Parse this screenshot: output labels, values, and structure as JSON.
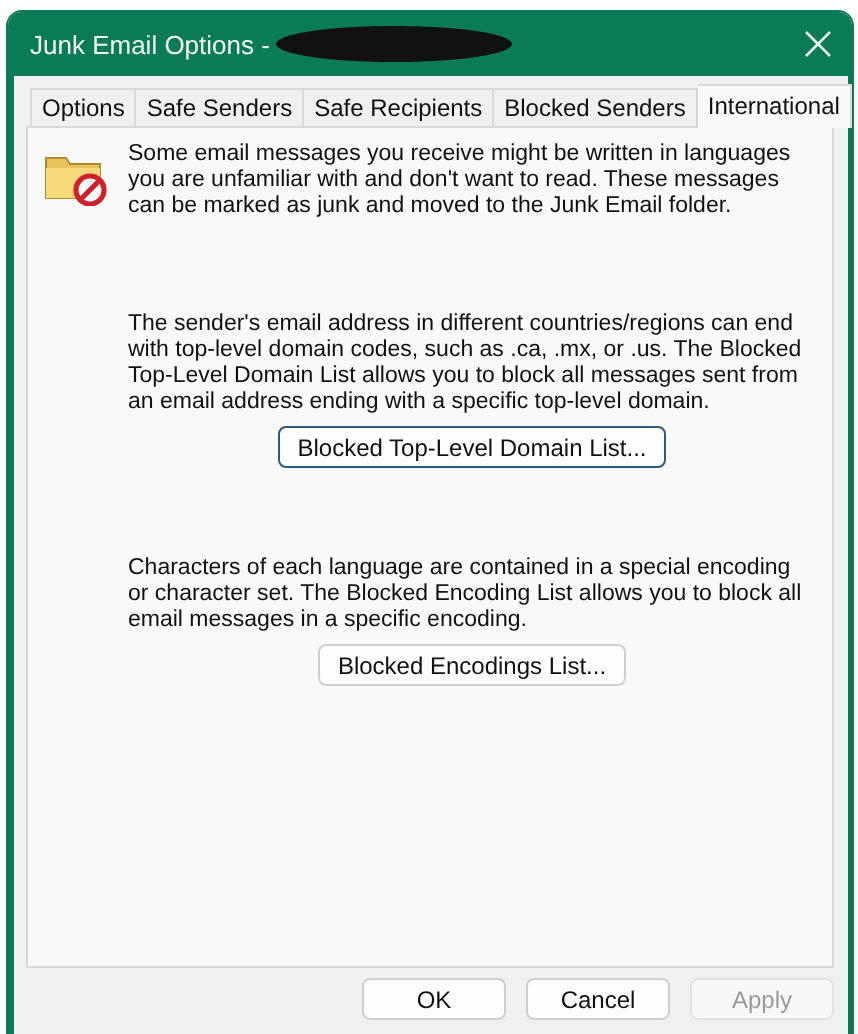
{
  "window": {
    "title": "Junk Email Options -"
  },
  "tabs": [
    {
      "label": "Options",
      "selected": false
    },
    {
      "label": "Safe Senders",
      "selected": false
    },
    {
      "label": "Safe Recipients",
      "selected": false
    },
    {
      "label": "Blocked Senders",
      "selected": false
    },
    {
      "label": "International",
      "selected": true
    }
  ],
  "intro": "Some email messages you receive might be written in languages you are unfamiliar with and don't want to read. These messages can be marked as junk and moved to the Junk Email folder.",
  "sections": [
    {
      "text": "The sender's email address in different countries/regions can end with top-level domain codes, such as .ca, .mx, or .us. The Blocked Top-Level Domain List allows you to block all messages sent from an email address ending with a specific top-level domain.",
      "button": "Blocked Top-Level Domain List...",
      "focused": true
    },
    {
      "text": "Characters of each language are contained in a special encoding or character set. The Blocked Encoding List allows you to block all email messages in a specific encoding.",
      "button": "Blocked Encodings List...",
      "focused": false
    }
  ],
  "buttons": [
    {
      "label": "OK",
      "disabled": false
    },
    {
      "label": "Cancel",
      "disabled": false
    },
    {
      "label": "Apply",
      "disabled": true
    }
  ]
}
